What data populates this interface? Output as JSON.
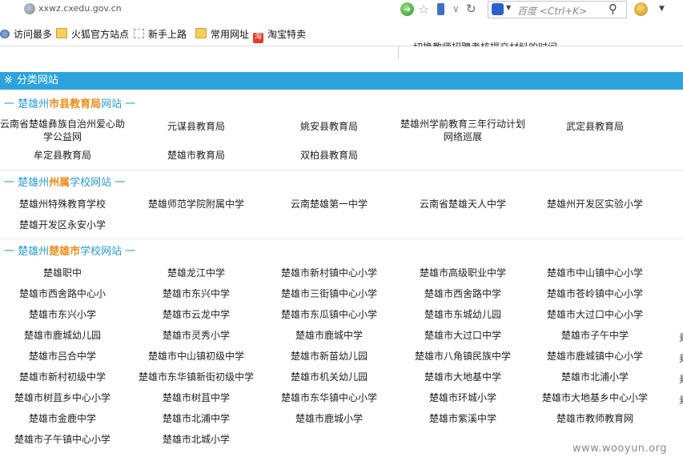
{
  "browser": {
    "url": "xxwz.cxedu.gov.cn",
    "search_placeholder": "百度 <Ctrl+K>"
  },
  "bookmarks": [
    {
      "label": "访问最多",
      "icon": "gear-icon"
    },
    {
      "label": "火狐官方站点",
      "icon": "folder-icon"
    },
    {
      "label": "新手上路",
      "icon": "page-icon"
    },
    {
      "label": "常用网址",
      "icon": "folder-icon"
    },
    {
      "label": "淘宝特卖",
      "icon": "taobao-icon",
      "icon_text": "淘"
    }
  ],
  "partial_notice": "切换教师招聘考核提交材料的时间",
  "header": {
    "mark": "※",
    "title": "分类网站"
  },
  "sections": [
    {
      "prefix": "一 楚雄州",
      "highlight": "市县教育局",
      "suffix": "网站 一",
      "rows": [
        [
          "云南省楚雄彝族自治州爱心助学公益网",
          "元谋县教育局",
          "姚安县教育局",
          "楚雄州学前教育三年行动计划网络巡展",
          "武定县教育局"
        ],
        [
          "牟定县教育局",
          "楚雄市教育局",
          "双柏县教育局"
        ]
      ]
    },
    {
      "prefix": "一 楚雄州",
      "highlight": "州属",
      "suffix": "学校网站 一",
      "rows": [
        [
          "楚雄州特殊教育学校",
          "楚雄师范学院附属中学",
          "云南楚雄第一中学",
          "云南省楚雄天人中学",
          "楚雄州开发区实验小学"
        ],
        [
          "楚雄开发区永安小学"
        ]
      ]
    },
    {
      "prefix": "一 楚雄州",
      "highlight": "楚雄市",
      "suffix": "学校网站 一",
      "rows": [
        [
          "楚雄职中",
          "楚雄龙江中学",
          "楚雄市新村镇中心小学",
          "楚雄市高级职业中学",
          "楚雄市中山镇中心小学"
        ],
        [
          "楚雄市西舍路中心小",
          "楚雄市东兴中学",
          "楚雄市三街镇中心小学",
          "楚雄市西舍路中学",
          "楚雄市苍岭镇中心小学"
        ],
        [
          "楚雄市东兴小学",
          "楚雄市云龙中学",
          "楚雄市东瓜镇中心小学",
          "楚雄市东城幼儿园",
          "楚雄市大过口中心小学"
        ],
        [
          "楚雄市鹿城幼儿园",
          "楚雄市灵秀小学",
          "楚雄市鹿城中学",
          "楚雄市大过口中学",
          "楚雄市子午中学"
        ],
        [
          "楚雄市吕合中学",
          "楚雄市中山镇初级中学",
          "楚雄市新苗幼儿园",
          "楚雄市八角镇民族中学",
          "楚雄市鹿城镇中心小学"
        ],
        [
          "楚雄市新村初级中学",
          "楚雄市东华镇新街初级中学",
          "楚雄市机关幼儿园",
          "楚雄市大地基中学",
          "楚雄市北浦小学"
        ],
        [
          "楚雄市树苴乡中心小学",
          "楚雄市树苴中学",
          "楚雄市东华镇中心小学",
          "楚雄市环城小学",
          "楚雄市大地基乡中心小学"
        ],
        [
          "楚雄市金鹿中学",
          "楚雄市北浦中学",
          "楚雄市鹿城小学",
          "楚雄市紫溪中学",
          "楚雄市教师教育网"
        ],
        [
          "楚雄市子午镇中心小学",
          "楚雄市北城小学"
        ]
      ]
    }
  ],
  "right_edge_peek": "乗",
  "watermark": "www.wooyun.org"
}
